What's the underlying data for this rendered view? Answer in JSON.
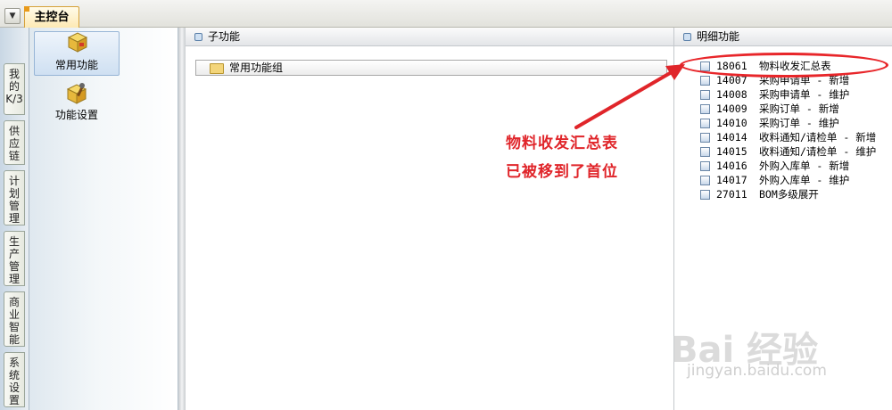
{
  "topbar": {
    "menu_icon": "dropdown-arrow-icon",
    "tab_title": "主控台"
  },
  "vertical_tabs": [
    "我的K/3",
    "供应链",
    "计划管理",
    "生产管理",
    "商业智能",
    "系统设置"
  ],
  "nav": {
    "items": [
      {
        "label": "常用功能",
        "icon": "box-icon",
        "selected": true
      },
      {
        "label": "功能设置",
        "icon": "settings-box-icon",
        "selected": false
      }
    ]
  },
  "sub_panel": {
    "header": "子功能",
    "group_label": "常用功能组"
  },
  "detail_panel": {
    "header": "明细功能",
    "rows": [
      {
        "code": "18061",
        "name": "物料收发汇总表"
      },
      {
        "code": "14007",
        "name": "采购申请单 - 新增"
      },
      {
        "code": "14008",
        "name": "采购申请单 - 维护"
      },
      {
        "code": "14009",
        "name": "采购订单 - 新增"
      },
      {
        "code": "14010",
        "name": "采购订单 - 维护"
      },
      {
        "code": "14014",
        "name": "收料通知/请检单 - 新增"
      },
      {
        "code": "14015",
        "name": "收料通知/请检单 - 维护"
      },
      {
        "code": "14016",
        "name": "外购入库单 - 新增"
      },
      {
        "code": "14017",
        "name": "外购入库单 - 维护"
      },
      {
        "code": "27011",
        "name": "BOM多级展开"
      }
    ]
  },
  "annotation": {
    "line1": "物料收发汇总表",
    "line2": "已被移到了首位",
    "color": "#e0252a"
  },
  "watermark": {
    "brand": "Bai  经验",
    "url": "jingyan.baidu.com"
  }
}
